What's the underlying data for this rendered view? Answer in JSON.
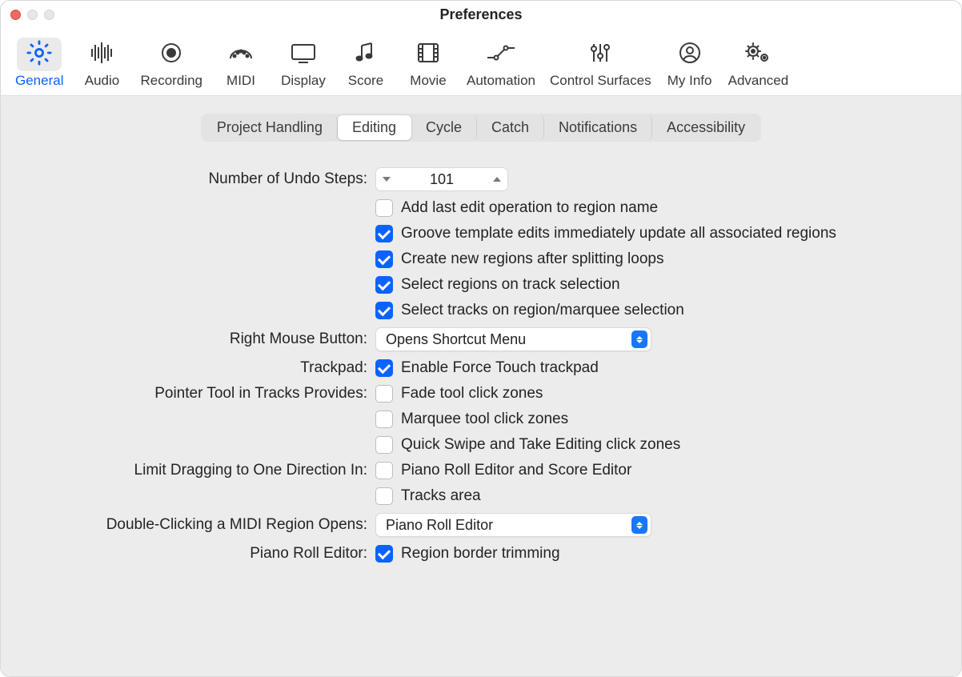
{
  "window": {
    "title": "Preferences"
  },
  "toolbar": {
    "items": [
      {
        "id": "general",
        "label": "General",
        "active": true
      },
      {
        "id": "audio",
        "label": "Audio"
      },
      {
        "id": "recording",
        "label": "Recording"
      },
      {
        "id": "midi",
        "label": "MIDI"
      },
      {
        "id": "display",
        "label": "Display"
      },
      {
        "id": "score",
        "label": "Score"
      },
      {
        "id": "movie",
        "label": "Movie"
      },
      {
        "id": "automation",
        "label": "Automation"
      },
      {
        "id": "control-surfaces",
        "label": "Control Surfaces"
      },
      {
        "id": "my-info",
        "label": "My Info"
      },
      {
        "id": "advanced",
        "label": "Advanced"
      }
    ]
  },
  "subtabs": {
    "items": [
      {
        "id": "project-handling",
        "label": "Project Handling"
      },
      {
        "id": "editing",
        "label": "Editing",
        "active": true
      },
      {
        "id": "cycle",
        "label": "Cycle"
      },
      {
        "id": "catch",
        "label": "Catch"
      },
      {
        "id": "notifications",
        "label": "Notifications"
      },
      {
        "id": "accessibility",
        "label": "Accessibility"
      }
    ]
  },
  "form": {
    "undo_label": "Number of Undo Steps:",
    "undo_value": "101",
    "cb1": "Add last edit operation to region name",
    "cb2": "Groove template edits immediately update all associated regions",
    "cb3": "Create new regions after splitting loops",
    "cb4": "Select regions on track selection",
    "cb5": "Select tracks on region/marquee selection",
    "rmb_label": "Right Mouse Button:",
    "rmb_value": "Opens Shortcut Menu",
    "trackpad_label": "Trackpad:",
    "cb6": "Enable Force Touch trackpad",
    "pointer_label": "Pointer Tool in Tracks Provides:",
    "cb7": "Fade tool click zones",
    "cb8": "Marquee tool click zones",
    "cb9": "Quick Swipe and Take Editing click zones",
    "limit_label": "Limit Dragging to One Direction In:",
    "cb10": "Piano Roll Editor and Score Editor",
    "cb11": "Tracks area",
    "dbl_label": "Double-Clicking a MIDI Region Opens:",
    "dbl_value": "Piano Roll Editor",
    "pre_label": "Piano Roll Editor:",
    "cb12": "Region border trimming"
  },
  "checked": {
    "cb1": false,
    "cb2": true,
    "cb3": true,
    "cb4": true,
    "cb5": true,
    "cb6": true,
    "cb7": false,
    "cb8": false,
    "cb9": false,
    "cb10": false,
    "cb11": false,
    "cb12": true
  }
}
